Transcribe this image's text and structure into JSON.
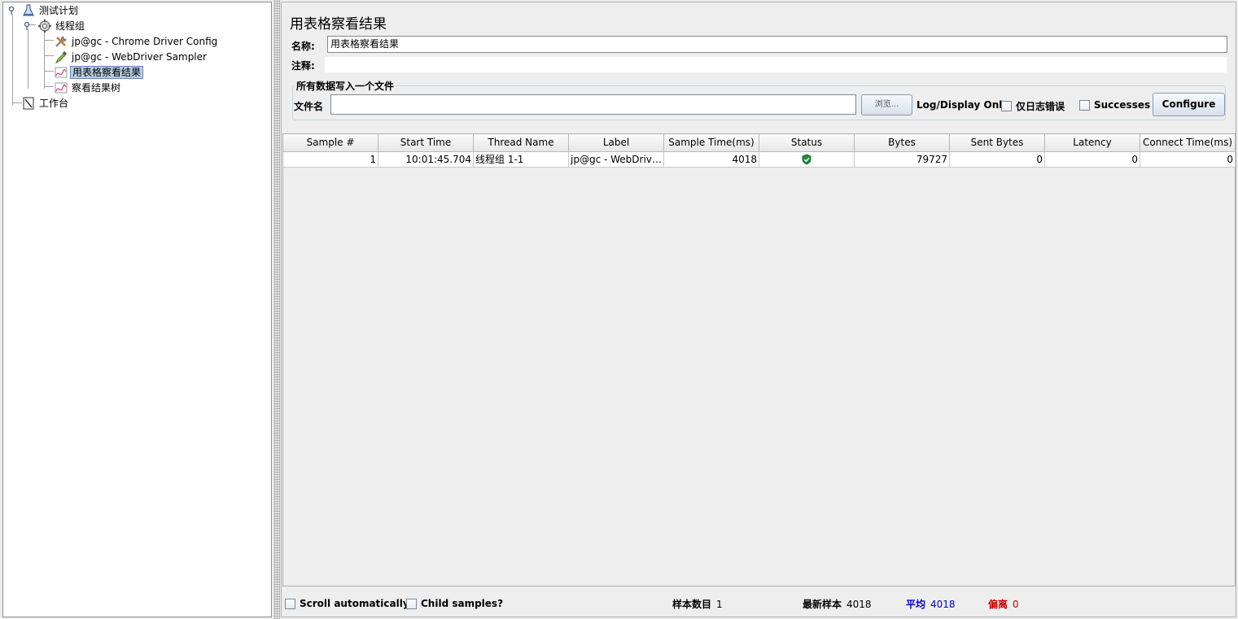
{
  "tree": {
    "items": [
      {
        "label": "测试计划"
      },
      {
        "label": "线程组"
      },
      {
        "label": "jp@gc - Chrome Driver Config"
      },
      {
        "label": "jp@gc - WebDriver Sampler"
      },
      {
        "label": "用表格察看结果"
      },
      {
        "label": "察看结果树"
      },
      {
        "label": "工作台"
      }
    ]
  },
  "panel": {
    "title": "用表格察看结果",
    "name_label": "名称:",
    "name_value": "用表格察看结果",
    "comment_label": "注释:",
    "comment_value": "",
    "file_group_title": "所有数据写入一个文件",
    "filename_label": "文件名",
    "filename_value": "",
    "browse_label": "浏览...",
    "log_display_label": "Log/Display Only:",
    "errors_only_label": "仅日志错误",
    "successes_label": "Successes",
    "configure_label": "Configure"
  },
  "table": {
    "columns": [
      "Sample #",
      "Start Time",
      "Thread Name",
      "Label",
      "Sample Time(ms)",
      "Status",
      "Bytes",
      "Sent Bytes",
      "Latency",
      "Connect Time(ms)"
    ],
    "rows": [
      {
        "sample": "1",
        "start_time": "10:01:45.704",
        "thread": "线程组 1-1",
        "label": "jp@gc - WebDriver ...",
        "sample_time": "4018",
        "status": "success",
        "bytes": "79727",
        "sent_bytes": "0",
        "latency": "0",
        "connect_time": "0"
      }
    ]
  },
  "footer": {
    "scroll_label": "Scroll automatically?",
    "child_label": "Child samples?",
    "count_label": "样本数目",
    "count_value": "1",
    "latest_label": "最新样本",
    "latest_value": "4018",
    "avg_label": "平均",
    "avg_value": "4018",
    "dev_label": "偏离",
    "dev_value": "0"
  },
  "colors": {
    "avg": "#0000cc",
    "dev": "#cc0000",
    "status_ok": "#1f8f3a",
    "selection": "#b8cfe5"
  }
}
